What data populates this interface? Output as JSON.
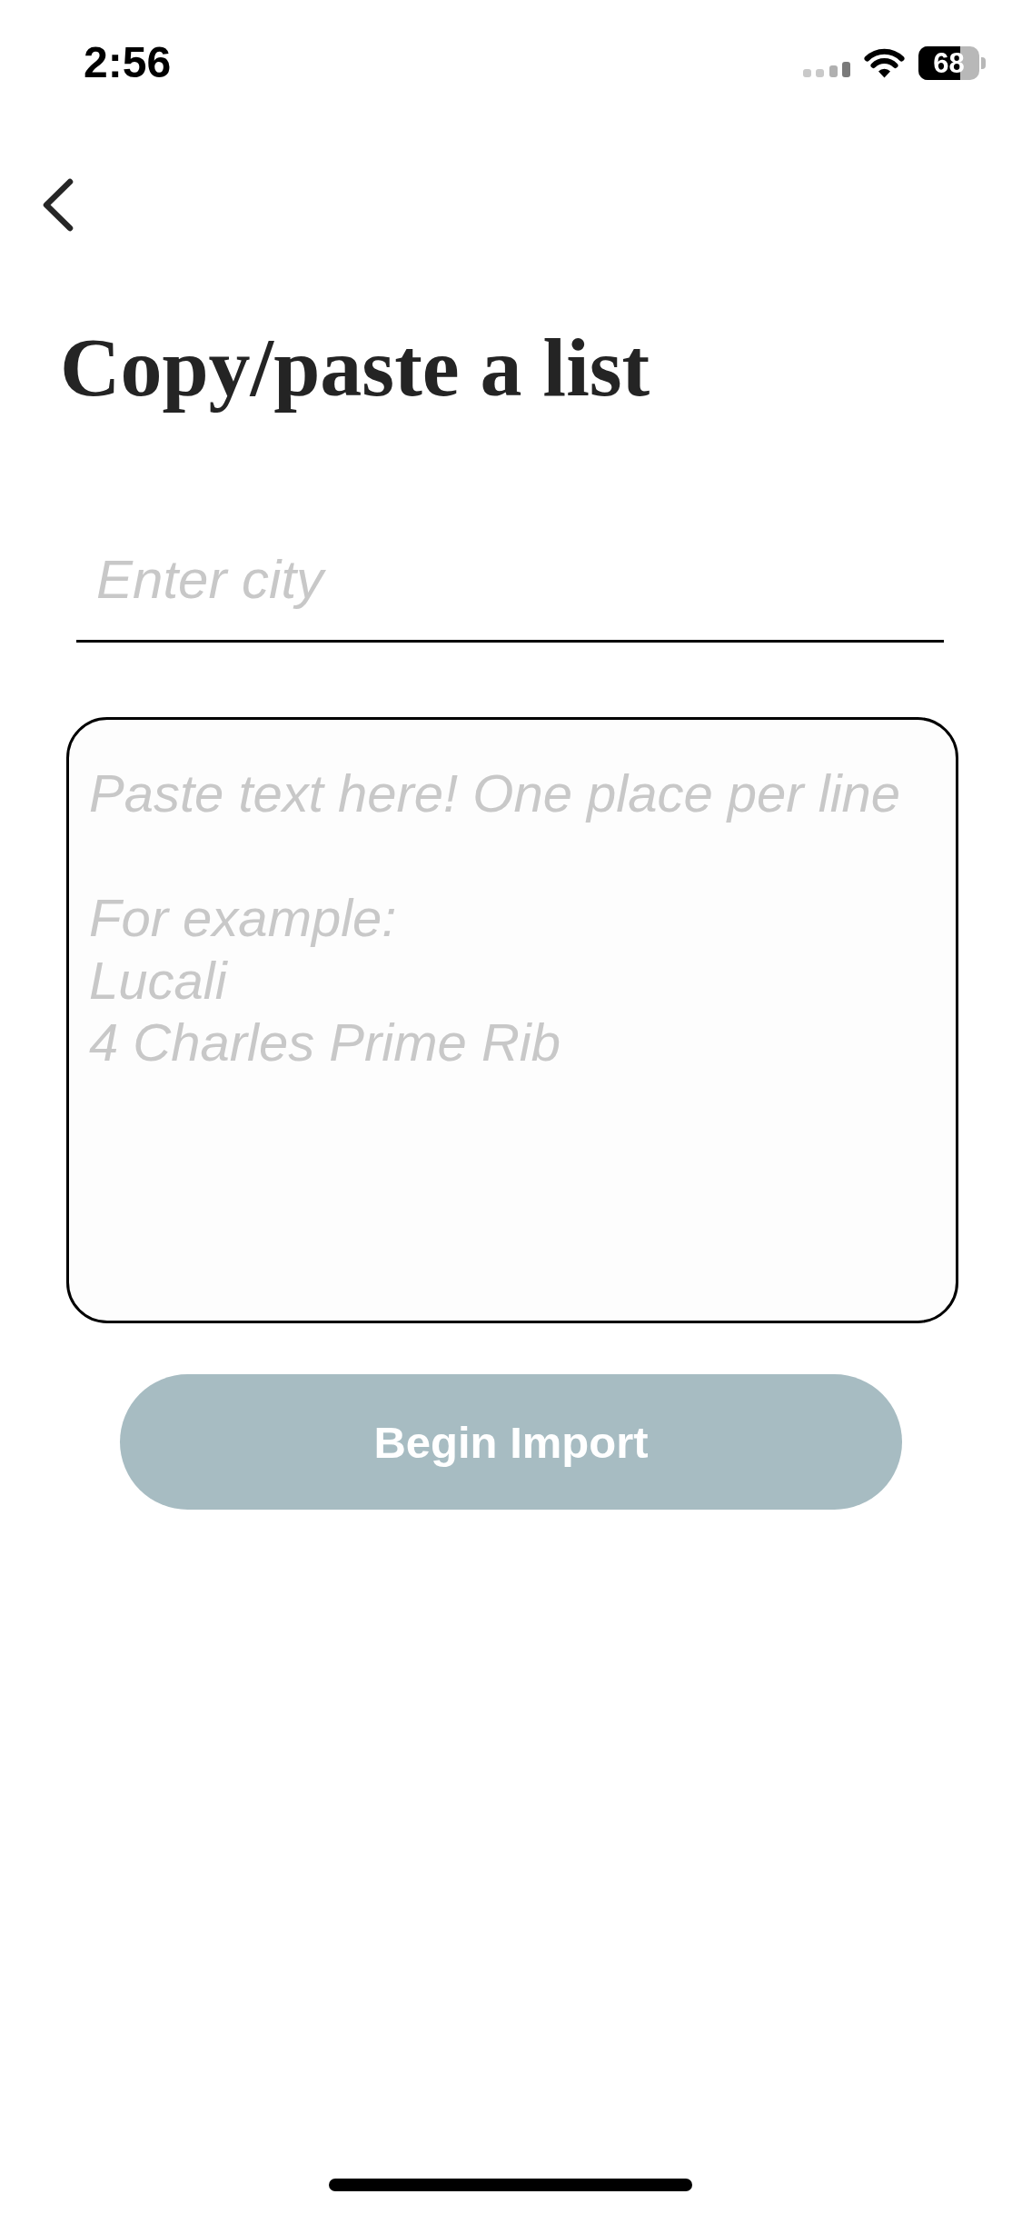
{
  "status_bar": {
    "time": "2:56",
    "battery": "68"
  },
  "title": "Copy/paste a list",
  "city_field": {
    "placeholder": "Enter city"
  },
  "list_field": {
    "placeholder": "Paste text here! One place per line\n\nFor example:\nLucali\n4 Charles Prime Rib"
  },
  "import_button": {
    "label": "Begin Import",
    "disabled": true
  }
}
